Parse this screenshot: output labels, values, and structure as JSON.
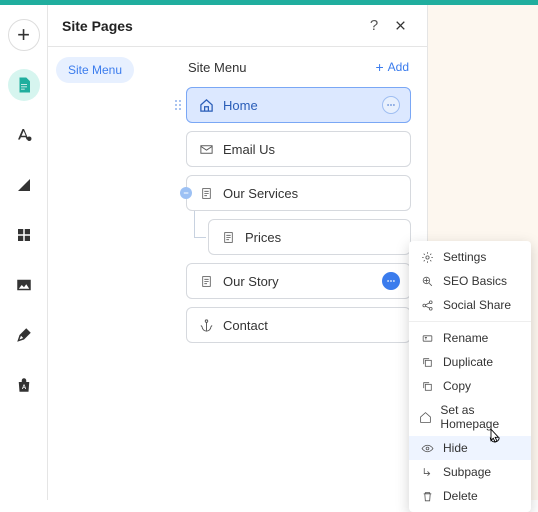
{
  "panel": {
    "title": "Site Pages",
    "nav_label": "Site Menu",
    "content_title": "Site Menu",
    "add_label": "Add"
  },
  "pages": {
    "home": "Home",
    "email": "Email Us",
    "services": "Our Services",
    "prices": "Prices",
    "story": "Our Story",
    "contact": "Contact"
  },
  "menu": {
    "settings": "Settings",
    "seo": "SEO Basics",
    "social": "Social Share",
    "rename": "Rename",
    "duplicate": "Duplicate",
    "copy": "Copy",
    "homepage": "Set as Homepage",
    "hide": "Hide",
    "subpage": "Subpage",
    "delete": "Delete"
  }
}
